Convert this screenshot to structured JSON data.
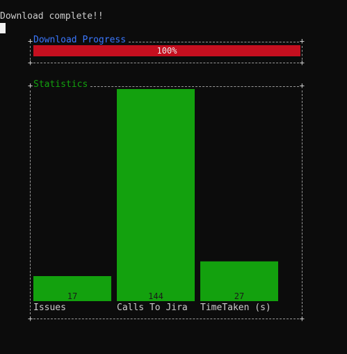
{
  "terminal": {
    "status_line": "Download complete!!"
  },
  "progress_panel": {
    "title": "Download Progress",
    "percent_label": "100%",
    "percent_value": 100,
    "fill_color": "#c50f1f",
    "title_color": "#3b78ff"
  },
  "stats_panel": {
    "title": "Statistics",
    "title_color": "#13a10e",
    "bar_color": "#13a10e"
  },
  "chart_data": {
    "type": "bar",
    "categories": [
      "Issues",
      "Calls To Jira",
      "TimeTaken (s)"
    ],
    "values": [
      17,
      144,
      27
    ],
    "title": "Statistics",
    "xlabel": "",
    "ylabel": "",
    "ylim": [
      0,
      144
    ]
  }
}
